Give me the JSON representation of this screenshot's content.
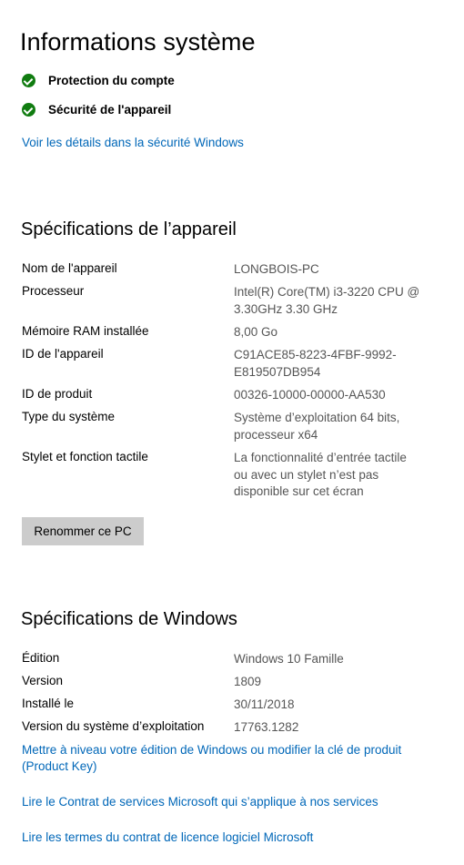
{
  "header": {
    "title": "Informations système"
  },
  "status": [
    {
      "label": "Protection du compte",
      "icon": "check-circle-icon"
    },
    {
      "label": "Sécurité de l'appareil",
      "icon": "check-circle-icon"
    }
  ],
  "security_link": "Voir les détails dans la sécurité Windows",
  "device_specs": {
    "title": "Spécifications de l’appareil",
    "rows": [
      {
        "key": "Nom de l'appareil",
        "value": "LONGBOIS-PC"
      },
      {
        "key": "Processeur",
        "value": "Intel(R) Core(TM) i3-3220 CPU @\n3.30GHz   3.30 GHz"
      },
      {
        "key": "Mémoire RAM installée",
        "value": "8,00 Go"
      },
      {
        "key": "ID de l'appareil",
        "value": "C91ACE85-8223-4FBF-9992-\nE819507DB954"
      },
      {
        "key": "ID de produit",
        "value": "00326-10000-00000-AA530"
      },
      {
        "key": "Type du système",
        "value": "Système d’exploitation 64 bits,\nprocesseur x64"
      },
      {
        "key": "Stylet et fonction tactile",
        "value": "La fonctionnalité d’entrée tactile\nou avec un stylet n’est pas\ndisponible sur cet écran"
      }
    ],
    "rename_button": "Renommer ce PC"
  },
  "windows_specs": {
    "title": "Spécifications de Windows",
    "rows": [
      {
        "key": "Édition",
        "value": "Windows 10 Famille"
      },
      {
        "key": "Version",
        "value": "1809"
      },
      {
        "key": "Installé le",
        "value": "30/11/2018"
      },
      {
        "key": "Version du système d’exploitation",
        "value": "17763.1282"
      }
    ]
  },
  "links": {
    "upgrade": "Mettre à niveau votre édition de Windows ou modifier la clé de produit (Product Key)",
    "services_agreement": "Lire le Contrat de services Microsoft qui s’applique à nos services",
    "license_terms": "Lire les termes du contrat de licence logiciel Microsoft"
  },
  "colors": {
    "accent_link": "#0067b8",
    "status_green": "#107c10",
    "button_bg": "#cccccc",
    "value_text": "#555555"
  }
}
